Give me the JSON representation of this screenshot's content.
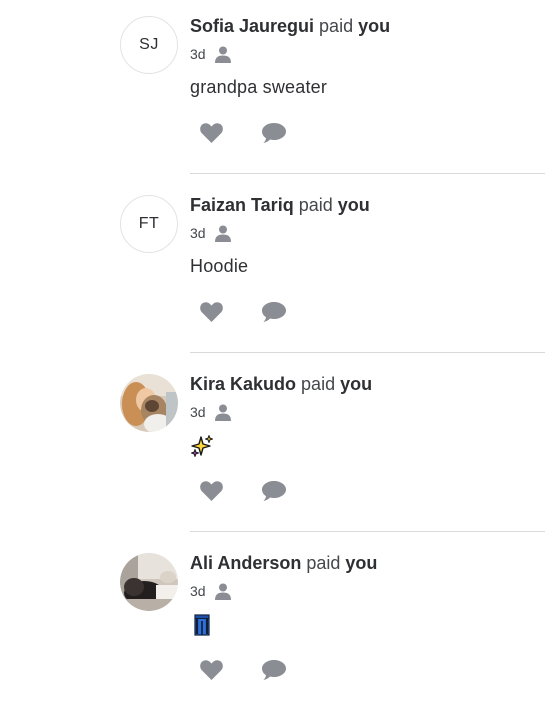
{
  "stories": [
    {
      "initials": "SJ",
      "name": "Sofia Jauregui",
      "verb": "paid",
      "target": "you",
      "time": "3d",
      "note": "grandpa sweater"
    },
    {
      "initials": "FT",
      "name": "Faizan Tariq",
      "verb": "paid",
      "target": "you",
      "time": "3d",
      "note": "Hoodie"
    },
    {
      "name": "Kira Kakudo",
      "verb": "paid",
      "target": "you",
      "time": "3d",
      "note_emoji": "sparkles"
    },
    {
      "name": "Ali Anderson",
      "verb": "paid",
      "target": "you",
      "time": "3d",
      "note_emoji": "jeans"
    }
  ],
  "icons": {
    "privacy": "person-icon",
    "like": "heart-icon",
    "comment": "speech-bubble-icon"
  },
  "colors": {
    "icon_gray": "#8a8d93",
    "text": "#2f3033",
    "divider": "#d9d9d9"
  }
}
